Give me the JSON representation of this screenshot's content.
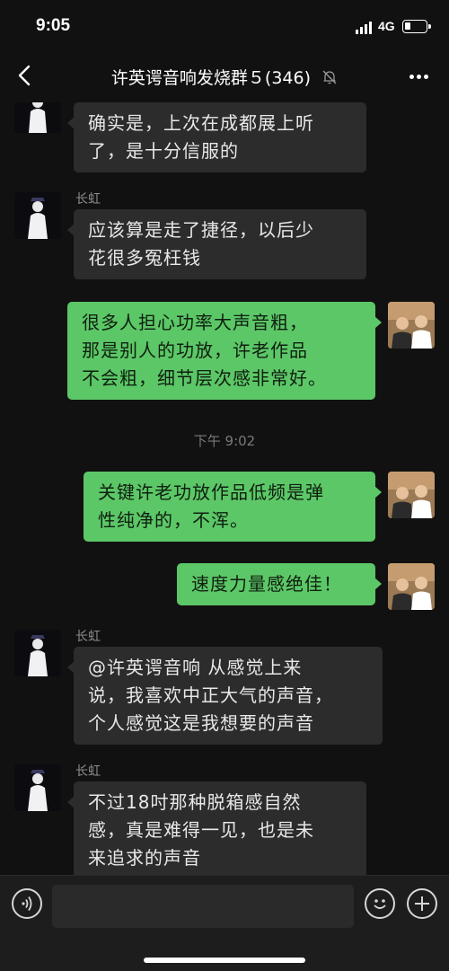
{
  "status_bar": {
    "time": "9:05",
    "network": "4G",
    "icons": [
      "signal-icon",
      "battery-icon"
    ]
  },
  "header": {
    "title": "许英谔音响发烧群５(346)",
    "icons": [
      "back-chevron-icon",
      "mute-bell-icon",
      "more-dots-icon"
    ]
  },
  "messages": [
    {
      "side": "left",
      "sender": "",
      "text": "确实是，上次在成都展上听了，是十分信服的",
      "line1": "确实是，上次在成都展上听",
      "line2": "了，是十分信服的",
      "line3": ""
    },
    {
      "side": "left",
      "sender": "长虹",
      "line1": "应该算是走了捷径，以后少",
      "line2": "花很多冤枉钱",
      "line3": ""
    },
    {
      "side": "right",
      "sender": "",
      "line1": "很多人担心功率大声音粗，",
      "line2": "那是别人的功放，许老作品",
      "line3": "不会粗，细节层次感非常好。"
    },
    {
      "side": "right",
      "sender": "",
      "line1": "关键许老功放作品低频是弹",
      "line2": "性纯净的，不浑。",
      "line3": ""
    },
    {
      "side": "right",
      "sender": "",
      "line1": "速度力量感绝佳！",
      "line2": "",
      "line3": ""
    },
    {
      "side": "left",
      "sender": "长虹",
      "line1": "@许英谔音响 从感觉上来",
      "line2": "说，我喜欢中正大气的声音，",
      "line3": "个人感觉这是我想要的声音"
    },
    {
      "side": "left",
      "sender": "长虹",
      "line1": "不过18吋那种脱箱感自然",
      "line2": "感，真是难得一见，也是未",
      "line3": "来追求的声音"
    }
  ],
  "timestamp": "下午 9:02",
  "input_bar": {
    "placeholder": "",
    "icons": [
      "voice-icon",
      "emoji-icon",
      "plus-icon"
    ]
  },
  "colors": {
    "background": "#111111",
    "incoming_bubble": "#2c2c2c",
    "outgoing_bubble": "#5cc767",
    "input_bar": "#1d1d1d"
  }
}
